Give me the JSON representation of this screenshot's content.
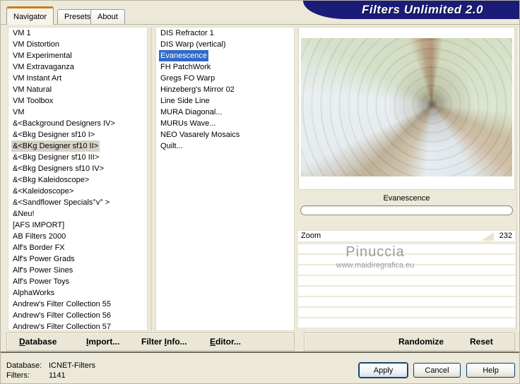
{
  "window": {
    "title": "Filters Unlimited 2.0"
  },
  "tabs": [
    {
      "label": "Navigator",
      "active": true
    },
    {
      "label": "Presets",
      "active": false
    },
    {
      "label": "About",
      "active": false
    }
  ],
  "category_list": {
    "selected_index": 10,
    "items": [
      "VM 1",
      "VM Distortion",
      "VM Experimental",
      "VM Extravaganza",
      "VM Instant Art",
      "VM Natural",
      "VM Toolbox",
      "VM",
      "&<Background Designers IV>",
      "&<Bkg Designer sf10 I>",
      "&<BKg Designer sf10 II>",
      "&<Bkg Designer sf10 III>",
      "&<Bkg Designers sf10 IV>",
      "&<Bkg Kaleidoscope>",
      "&<Kaleidoscope>",
      "&<Sandflower Specials°v° >",
      "&Neu!",
      "[AFS IMPORT]",
      "AB Filters 2000",
      "Alf's Border FX",
      "Alf's Power Grads",
      "Alf's Power Sines",
      "Alf's Power Toys",
      "AlphaWorks",
      "Andrew's Filter Collection 55",
      "Andrew's Filter Collection 56",
      "Andrew's Filter Collection 57"
    ]
  },
  "filter_list": {
    "selected_index": 2,
    "items": [
      "DIS Refractor 1",
      "DIS Warp (vertical)",
      "Evanescence",
      "FH PatchWork",
      "Gregs FO Warp",
      "Hinzeberg's Mirror 02",
      "Line Side Line",
      "MURA Diagonal...",
      "MURUs Wave...",
      "NEO Vasarely Mosaics",
      "Quilt..."
    ]
  },
  "preview": {
    "filter_name_label": "Evanescence"
  },
  "params": {
    "zoom_label": "Zoom",
    "zoom_value": "232",
    "empty_rows": 8,
    "watermark_title": "Pinuccia",
    "watermark_url": "www.maidiregrafica.eu"
  },
  "toolbar": {
    "database": {
      "pre": "",
      "key": "D",
      "post": "atabase"
    },
    "import": {
      "pre": "",
      "key": "I",
      "post": "mport..."
    },
    "filter_info": {
      "pre": "Filter ",
      "key": "I",
      "post": "nfo..."
    },
    "editor": {
      "pre": "",
      "key": "E",
      "post": "ditor..."
    },
    "randomize": "Randomize",
    "reset": "Reset"
  },
  "status": {
    "database_label": "Database:",
    "database_value": "ICNET-Filters",
    "filters_label": "Filters:",
    "filters_value": "1141"
  },
  "buttons": {
    "apply": "Apply",
    "cancel": "Cancel",
    "help": "Help"
  },
  "colors": {
    "dialog_bg": "#ECE9D8",
    "banner_navy": "#1B1B78",
    "selection_blue": "#316AC5",
    "category_selection": "#D7D3C7",
    "tab_accent_orange": "#CF7B1E"
  }
}
